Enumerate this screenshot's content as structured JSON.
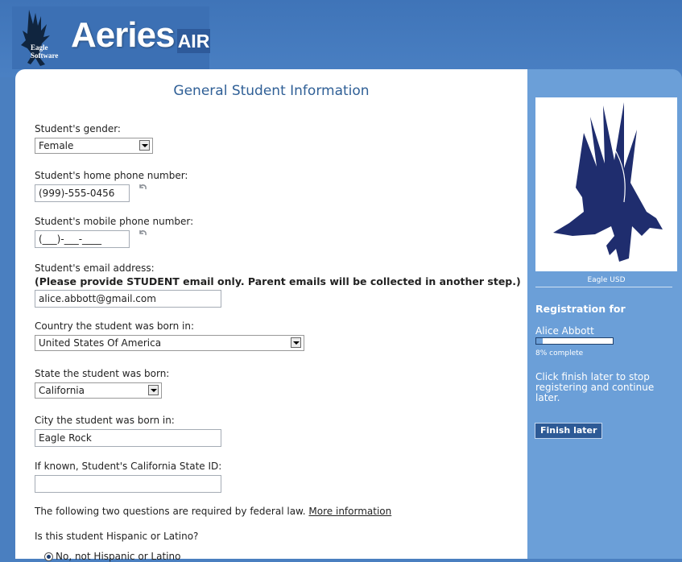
{
  "header": {
    "logo_small_line1": "Eagle",
    "logo_small_line2": "Software",
    "logo_brand": "Aeries",
    "logo_suffix": "AIR"
  },
  "form": {
    "title": "General Student Information",
    "gender": {
      "label": "Student's gender:",
      "value": "Female"
    },
    "home_phone": {
      "label": "Student's home phone number:",
      "value": "(999)-555-0456"
    },
    "mobile_phone": {
      "label": "Student's mobile phone number:",
      "value": "(___)-___-____"
    },
    "email": {
      "label": "Student's email address:",
      "note": "(Please provide STUDENT email only. Parent emails will be collected in another step.)",
      "value": "alice.abbott@gmail.com"
    },
    "country": {
      "label": "Country the student was born in:",
      "value": "United States Of America"
    },
    "state": {
      "label": "State the student was born:",
      "value": "California"
    },
    "city": {
      "label": "City the student was born in:",
      "value": "Eagle Rock"
    },
    "state_id": {
      "label": "If known, Student's California State ID:",
      "value": ""
    },
    "federal_note": "The following two questions are required by federal law.",
    "more_info_link": "More information",
    "hispanic": {
      "question": "Is this student Hispanic or Latino?",
      "selected_option": "No, not Hispanic or Latino"
    }
  },
  "sidebar": {
    "district": "Eagle USD",
    "registration_for": "Registration for",
    "student_name": "Alice Abbott",
    "progress_percent": 8,
    "progress_text": "8% complete",
    "finish_message": "Click finish later to stop registering and continue later.",
    "finish_button": "Finish later"
  },
  "colors": {
    "page_background": "#4a7fc0",
    "sidebar_background": "#6b9fd8",
    "title_color": "#2f5f96",
    "button_background": "#2d5a96"
  },
  "icons": [
    "eagle-logo-icon",
    "undo-icon",
    "dropdown-arrow-icon",
    "radio-icon"
  ]
}
